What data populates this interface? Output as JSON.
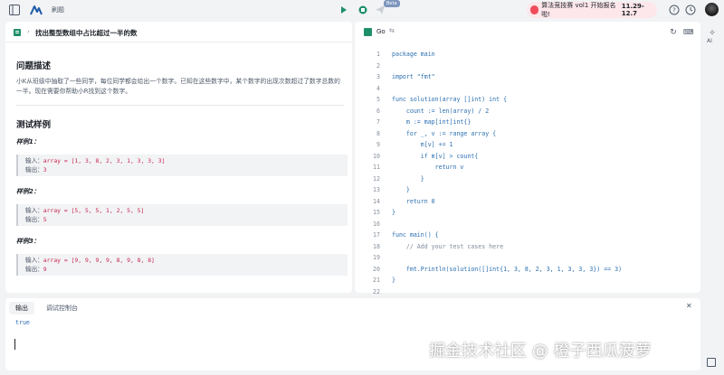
{
  "topbar": {
    "title": "刷题",
    "beta": "Beta",
    "banner_text": "算法竞技赛 vol1 开始报名啦!",
    "banner_dates": "11.29-12.7"
  },
  "problem": {
    "title": "找出整型数组中占比超过一半的数",
    "section_desc": "问题描述",
    "description": "小K从班级中抽取了一些同学，每位同学都会给出一个数字。已知在这些数字中，某个数字的出现次数超过了数字总数的一半。现在需要你帮助小R找到这个数字。",
    "section_tests": "测试样例",
    "examples": [
      {
        "title": "样例1：",
        "input_label": "输入：",
        "input": "array = [1, 3, 8, 2, 3, 1, 3, 3, 3]",
        "output_label": "输出：",
        "output": "3"
      },
      {
        "title": "样例2：",
        "input_label": "输入：",
        "input": "array = [5, 5, 5, 1, 2, 5, 5]",
        "output_label": "输出：",
        "output": "5"
      },
      {
        "title": "样例3：",
        "input_label": "输入：",
        "input": "array = [9, 9, 9, 9, 8, 9, 8, 8]",
        "output_label": "输出：",
        "output": "9"
      }
    ]
  },
  "editor": {
    "language": "Go",
    "lines": [
      {
        "n": "1",
        "text": "package main"
      },
      {
        "n": "2",
        "text": ""
      },
      {
        "n": "3",
        "text": "import \"fmt\""
      },
      {
        "n": "4",
        "text": ""
      },
      {
        "n": "5",
        "text": "func solution(array []int) int {"
      },
      {
        "n": "6",
        "text": "    count := len(array) / 2"
      },
      {
        "n": "7",
        "text": "    m := map[int]int{}"
      },
      {
        "n": "8",
        "text": "    for _, v := range array {"
      },
      {
        "n": "9",
        "text": "        m[v] += 1"
      },
      {
        "n": "10",
        "text": "        if m[v] > count{"
      },
      {
        "n": "11",
        "text": "            return v"
      },
      {
        "n": "12",
        "text": "        }"
      },
      {
        "n": "13",
        "text": "    }"
      },
      {
        "n": "14",
        "text": "    return 0"
      },
      {
        "n": "15",
        "text": "}"
      },
      {
        "n": "16",
        "text": ""
      },
      {
        "n": "17",
        "text": "func main() {"
      },
      {
        "n": "18",
        "text": "    // Add your test cases here"
      },
      {
        "n": "19",
        "text": ""
      },
      {
        "n": "20",
        "text": "    fmt.Println(solution([]int{1, 3, 8, 2, 3, 1, 3, 3, 3}) == 3)"
      },
      {
        "n": "21",
        "text": "}"
      },
      {
        "n": "22",
        "text": ""
      }
    ]
  },
  "sidebar": {
    "ai_label": "AI"
  },
  "console": {
    "tab_output": "输出",
    "tab_debug": "调试控制台",
    "output": "true"
  },
  "watermark": "掘金技术社区 @ 橙子西瓜菠萝"
}
